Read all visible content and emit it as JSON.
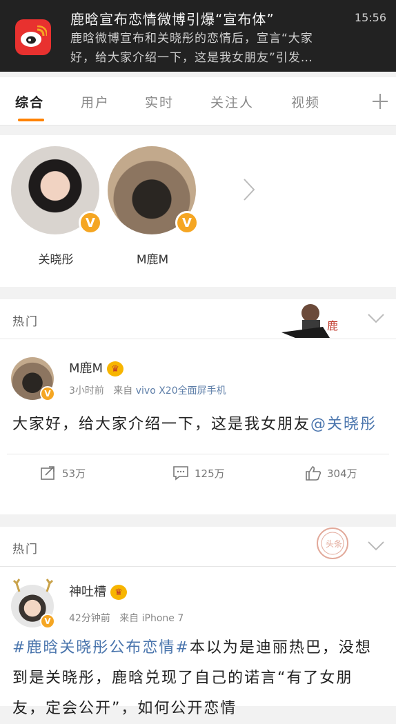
{
  "notification": {
    "title": "鹿晗宣布恋情微博引爆“宣布体”",
    "time": "15:56",
    "body_line1": "鹿晗微博宣布和关晓彤的恋情后，宣言“大家",
    "body_line2": "好，给大家介绍一下，这是我女朋友”引发…"
  },
  "tabs": [
    "综合",
    "用户",
    "实时",
    "关注人",
    "视频"
  ],
  "users": [
    {
      "name": "关晓彤"
    },
    {
      "name": "M鹿M"
    }
  ],
  "post1": {
    "section": "热门",
    "author": "M鹿M",
    "time": "3小时前",
    "from": "来自",
    "source": "vivo X20全面屏手机",
    "text": "大家好，给大家介绍一下，这是我女朋友",
    "mention": "@关晓彤",
    "reposts": "53万",
    "comments": "125万",
    "likes": "304万"
  },
  "post2": {
    "section": "热门",
    "author": "神吐槽",
    "time": "42分钟前",
    "from": "来自",
    "source": "iPhone 7",
    "hashtag": "#鹿晗关晓彤公布恋情#",
    "text": "本以为是迪丽热巴，没想到是关晓彤，鹿晗兑现了自己的诺言“有了女朋友，定会公开”，如何公开恋情"
  },
  "colors": {
    "accent": "#ff8200",
    "link": "#4a75ad",
    "verify": "#f5a623"
  }
}
